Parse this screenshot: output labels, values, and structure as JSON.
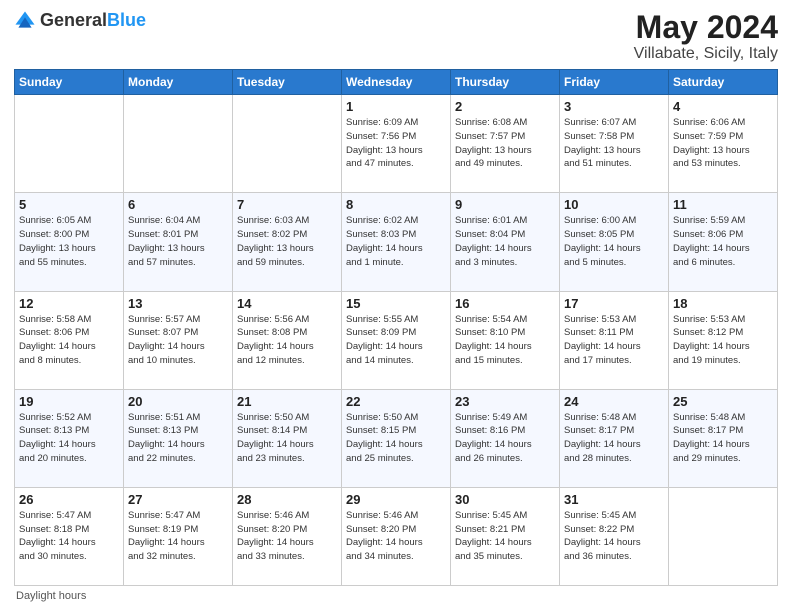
{
  "header": {
    "logo_general": "General",
    "logo_blue": "Blue",
    "month_title": "May 2024",
    "location": "Villabate, Sicily, Italy"
  },
  "calendar": {
    "days_of_week": [
      "Sunday",
      "Monday",
      "Tuesday",
      "Wednesday",
      "Thursday",
      "Friday",
      "Saturday"
    ],
    "weeks": [
      [
        {
          "day": "",
          "info": ""
        },
        {
          "day": "",
          "info": ""
        },
        {
          "day": "",
          "info": ""
        },
        {
          "day": "1",
          "info": "Sunrise: 6:09 AM\nSunset: 7:56 PM\nDaylight: 13 hours\nand 47 minutes."
        },
        {
          "day": "2",
          "info": "Sunrise: 6:08 AM\nSunset: 7:57 PM\nDaylight: 13 hours\nand 49 minutes."
        },
        {
          "day": "3",
          "info": "Sunrise: 6:07 AM\nSunset: 7:58 PM\nDaylight: 13 hours\nand 51 minutes."
        },
        {
          "day": "4",
          "info": "Sunrise: 6:06 AM\nSunset: 7:59 PM\nDaylight: 13 hours\nand 53 minutes."
        }
      ],
      [
        {
          "day": "5",
          "info": "Sunrise: 6:05 AM\nSunset: 8:00 PM\nDaylight: 13 hours\nand 55 minutes."
        },
        {
          "day": "6",
          "info": "Sunrise: 6:04 AM\nSunset: 8:01 PM\nDaylight: 13 hours\nand 57 minutes."
        },
        {
          "day": "7",
          "info": "Sunrise: 6:03 AM\nSunset: 8:02 PM\nDaylight: 13 hours\nand 59 minutes."
        },
        {
          "day": "8",
          "info": "Sunrise: 6:02 AM\nSunset: 8:03 PM\nDaylight: 14 hours\nand 1 minute."
        },
        {
          "day": "9",
          "info": "Sunrise: 6:01 AM\nSunset: 8:04 PM\nDaylight: 14 hours\nand 3 minutes."
        },
        {
          "day": "10",
          "info": "Sunrise: 6:00 AM\nSunset: 8:05 PM\nDaylight: 14 hours\nand 5 minutes."
        },
        {
          "day": "11",
          "info": "Sunrise: 5:59 AM\nSunset: 8:06 PM\nDaylight: 14 hours\nand 6 minutes."
        }
      ],
      [
        {
          "day": "12",
          "info": "Sunrise: 5:58 AM\nSunset: 8:06 PM\nDaylight: 14 hours\nand 8 minutes."
        },
        {
          "day": "13",
          "info": "Sunrise: 5:57 AM\nSunset: 8:07 PM\nDaylight: 14 hours\nand 10 minutes."
        },
        {
          "day": "14",
          "info": "Sunrise: 5:56 AM\nSunset: 8:08 PM\nDaylight: 14 hours\nand 12 minutes."
        },
        {
          "day": "15",
          "info": "Sunrise: 5:55 AM\nSunset: 8:09 PM\nDaylight: 14 hours\nand 14 minutes."
        },
        {
          "day": "16",
          "info": "Sunrise: 5:54 AM\nSunset: 8:10 PM\nDaylight: 14 hours\nand 15 minutes."
        },
        {
          "day": "17",
          "info": "Sunrise: 5:53 AM\nSunset: 8:11 PM\nDaylight: 14 hours\nand 17 minutes."
        },
        {
          "day": "18",
          "info": "Sunrise: 5:53 AM\nSunset: 8:12 PM\nDaylight: 14 hours\nand 19 minutes."
        }
      ],
      [
        {
          "day": "19",
          "info": "Sunrise: 5:52 AM\nSunset: 8:13 PM\nDaylight: 14 hours\nand 20 minutes."
        },
        {
          "day": "20",
          "info": "Sunrise: 5:51 AM\nSunset: 8:13 PM\nDaylight: 14 hours\nand 22 minutes."
        },
        {
          "day": "21",
          "info": "Sunrise: 5:50 AM\nSunset: 8:14 PM\nDaylight: 14 hours\nand 23 minutes."
        },
        {
          "day": "22",
          "info": "Sunrise: 5:50 AM\nSunset: 8:15 PM\nDaylight: 14 hours\nand 25 minutes."
        },
        {
          "day": "23",
          "info": "Sunrise: 5:49 AM\nSunset: 8:16 PM\nDaylight: 14 hours\nand 26 minutes."
        },
        {
          "day": "24",
          "info": "Sunrise: 5:48 AM\nSunset: 8:17 PM\nDaylight: 14 hours\nand 28 minutes."
        },
        {
          "day": "25",
          "info": "Sunrise: 5:48 AM\nSunset: 8:17 PM\nDaylight: 14 hours\nand 29 minutes."
        }
      ],
      [
        {
          "day": "26",
          "info": "Sunrise: 5:47 AM\nSunset: 8:18 PM\nDaylight: 14 hours\nand 30 minutes."
        },
        {
          "day": "27",
          "info": "Sunrise: 5:47 AM\nSunset: 8:19 PM\nDaylight: 14 hours\nand 32 minutes."
        },
        {
          "day": "28",
          "info": "Sunrise: 5:46 AM\nSunset: 8:20 PM\nDaylight: 14 hours\nand 33 minutes."
        },
        {
          "day": "29",
          "info": "Sunrise: 5:46 AM\nSunset: 8:20 PM\nDaylight: 14 hours\nand 34 minutes."
        },
        {
          "day": "30",
          "info": "Sunrise: 5:45 AM\nSunset: 8:21 PM\nDaylight: 14 hours\nand 35 minutes."
        },
        {
          "day": "31",
          "info": "Sunrise: 5:45 AM\nSunset: 8:22 PM\nDaylight: 14 hours\nand 36 minutes."
        },
        {
          "day": "",
          "info": ""
        }
      ]
    ]
  },
  "footer": {
    "note": "Daylight hours"
  }
}
